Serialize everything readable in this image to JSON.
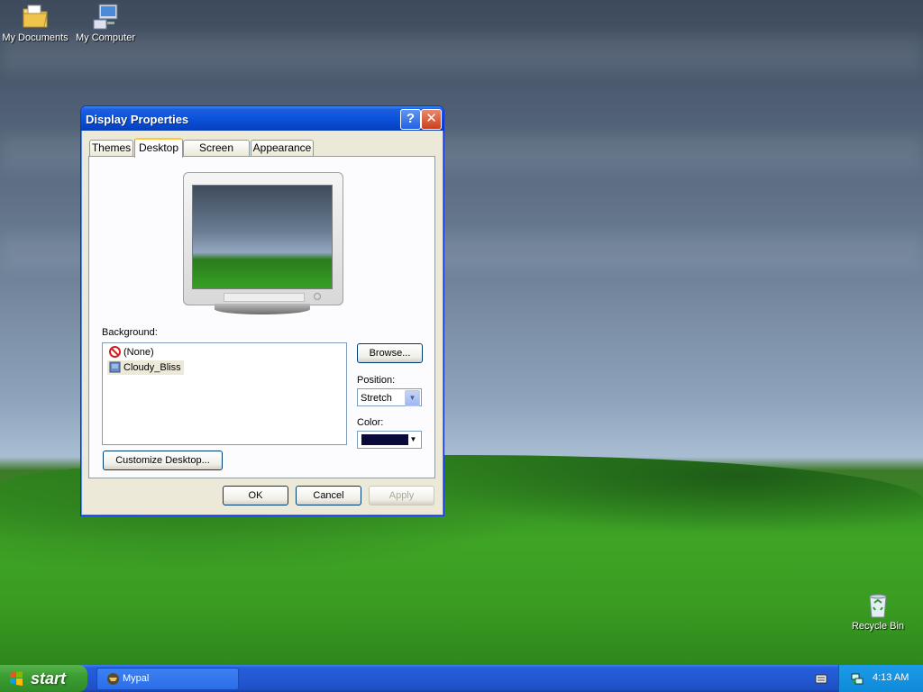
{
  "desktop": {
    "icons": [
      {
        "label": "My Documents",
        "icon": "my-documents-icon"
      },
      {
        "label": "My Computer",
        "icon": "my-computer-icon"
      },
      {
        "label": "Recycle Bin",
        "icon": "recycle-bin-icon"
      }
    ]
  },
  "window": {
    "title": "Display Properties",
    "help_button": "?",
    "close_button": "✕",
    "tabs": [
      {
        "label": "Themes"
      },
      {
        "label": "Desktop"
      },
      {
        "label": "Screen Saver"
      },
      {
        "label": "Appearance"
      }
    ],
    "active_tab": "Desktop",
    "background_label": "Background:",
    "background_items": [
      {
        "label": "(None)",
        "icon": "none-icon"
      },
      {
        "label": "Cloudy_Bliss",
        "icon": "image-file-icon"
      }
    ],
    "browse_button": "Browse...",
    "position_label": "Position:",
    "position_value": "Stretch",
    "color_label": "Color:",
    "color_value": "#0a0a3a",
    "customize_button": "Customize Desktop...",
    "ok_button": "OK",
    "cancel_button": "Cancel",
    "apply_button": "Apply"
  },
  "taskbar": {
    "start_label": "start",
    "task_label": "Mypal",
    "clock": "4:13 AM"
  }
}
